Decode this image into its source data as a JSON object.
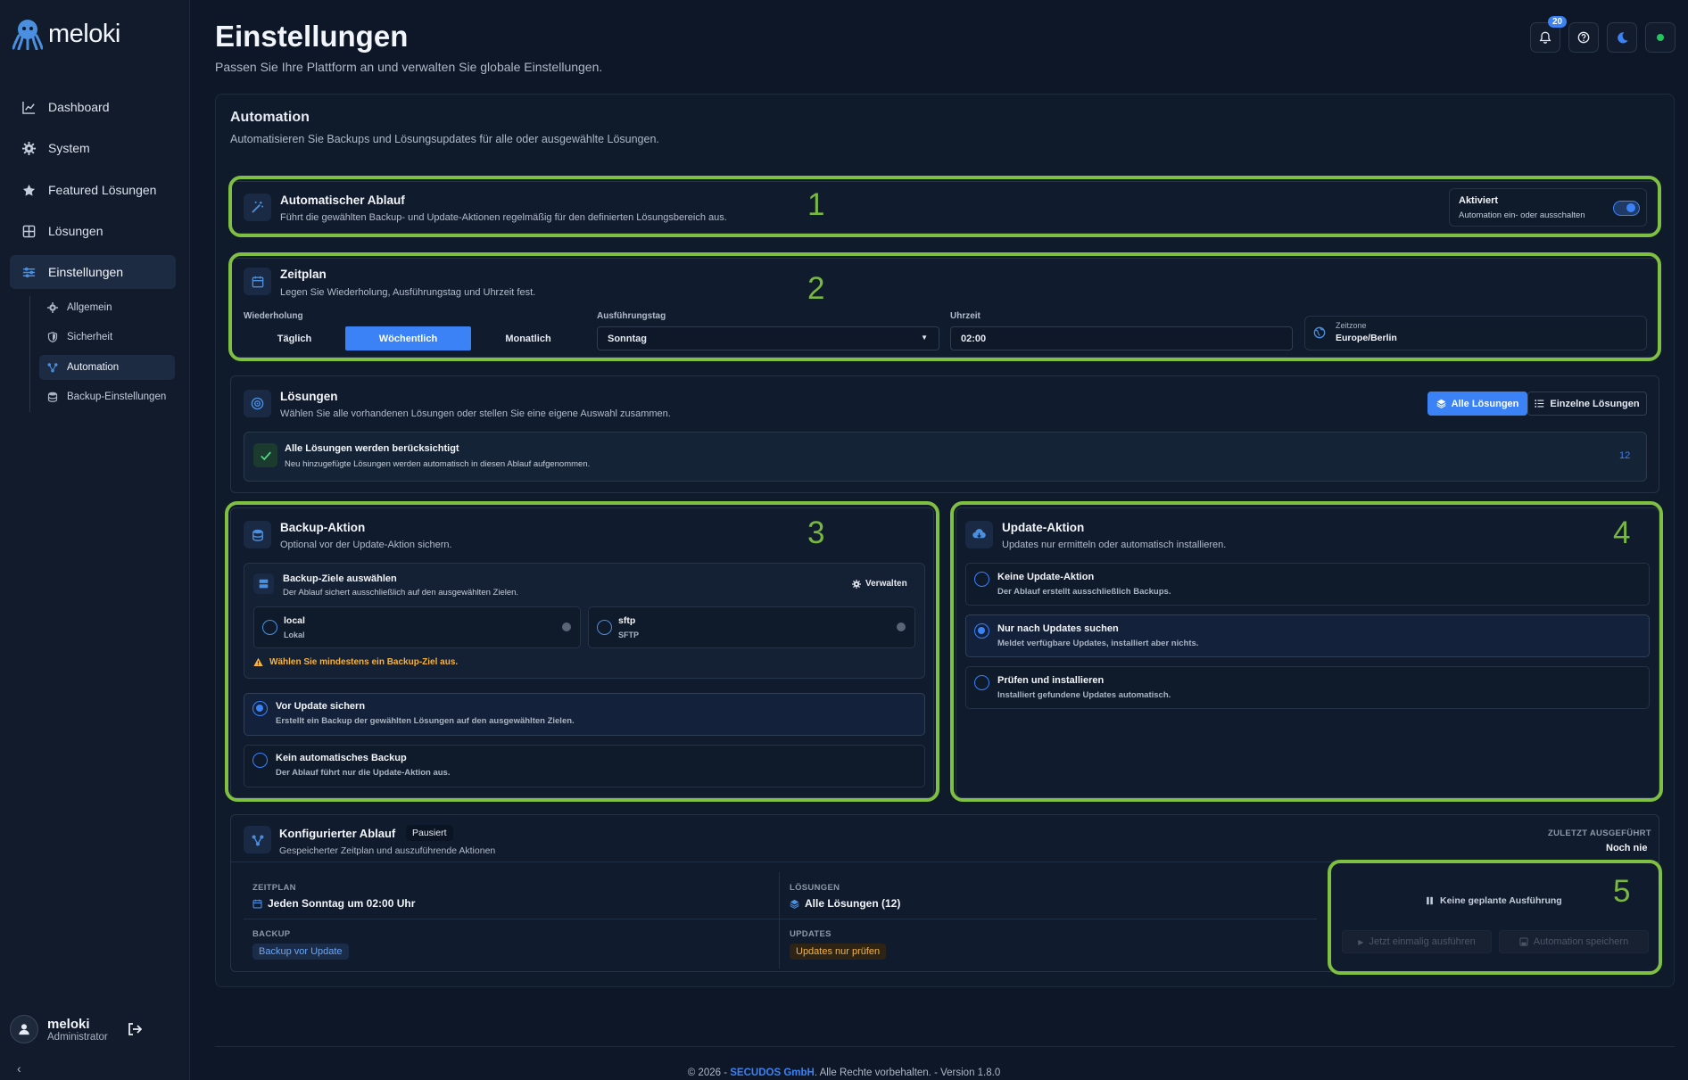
{
  "app": {
    "name": "meloki"
  },
  "sidebar": {
    "items": [
      {
        "label": "Dashboard"
      },
      {
        "label": "System"
      },
      {
        "label": "Featured Lösungen"
      },
      {
        "label": "Lösungen"
      },
      {
        "label": "Einstellungen"
      }
    ],
    "sub_items": [
      {
        "label": "Allgemein"
      },
      {
        "label": "Sicherheit"
      },
      {
        "label": "Automation"
      },
      {
        "label": "Backup-Einstellungen"
      }
    ],
    "user": {
      "name": "meloki",
      "role": "Administrator"
    }
  },
  "header": {
    "title": "Einstellungen",
    "subtitle": "Passen Sie Ihre Plattform an und verwalten Sie globale Einstellungen.",
    "notification_count": "20",
    "status_color": "#22c55e"
  },
  "automation": {
    "title": "Automation",
    "description": "Automatisieren Sie Backups und Lösungsupdates für alle oder ausgewählte Lösungen."
  },
  "annotations": [
    "1",
    "2",
    "3",
    "4",
    "5"
  ],
  "ablauf": {
    "title": "Automatischer Ablauf",
    "description": "Führt die gewählten Backup- und Update-Aktionen regelmäßig für den definierten Lösungsbereich aus.",
    "toggle_title": "Aktiviert",
    "toggle_desc": "Automation ein- oder ausschalten",
    "enabled": true
  },
  "zeitplan": {
    "title": "Zeitplan",
    "description": "Legen Sie Wiederholung, Ausführungstag und Uhrzeit fest.",
    "wiederholung_label": "Wiederholung",
    "options": [
      "Täglich",
      "Wöchentlich",
      "Monatlich"
    ],
    "selected": "Wöchentlich",
    "tag_label": "Ausführungstag",
    "tag_value": "Sonntag",
    "uhrzeit_label": "Uhrzeit",
    "uhrzeit_value": "02:00",
    "zeitzone_label": "Zeitzone",
    "zeitzone_value": "Europe/Berlin"
  },
  "loesungen": {
    "title": "Lösungen",
    "description": "Wählen Sie alle vorhandenen Lösungen oder stellen Sie eine eigene Auswahl zusammen.",
    "btn_all": "Alle Lösungen",
    "btn_single": "Einzelne Lösungen",
    "info_title": "Alle Lösungen werden berücksichtigt",
    "info_desc": "Neu hinzugefügte Lösungen werden automatisch in diesen Ablauf aufgenommen.",
    "count": "12"
  },
  "backup": {
    "title": "Backup-Aktion",
    "description": "Optional vor der Update-Aktion sichern.",
    "targets_title": "Backup-Ziele auswählen",
    "targets_desc": "Der Ablauf sichert ausschließlich auf den ausgewählten Zielen.",
    "manage": "Verwalten",
    "targets": [
      {
        "name": "local",
        "type": "Lokal"
      },
      {
        "name": "sftp",
        "type": "SFTP"
      }
    ],
    "warning": "Wählen Sie mindestens ein Backup-Ziel aus.",
    "options": [
      {
        "title": "Vor Update sichern",
        "desc": "Erstellt ein Backup der gewählten Lösungen auf den ausgewählten Zielen.",
        "selected": true
      },
      {
        "title": "Kein automatisches Backup",
        "desc": "Der Ablauf führt nur die Update-Aktion aus.",
        "selected": false
      }
    ]
  },
  "update": {
    "title": "Update-Aktion",
    "description": "Updates nur ermitteln oder automatisch installieren.",
    "options": [
      {
        "title": "Keine Update-Aktion",
        "desc": "Der Ablauf erstellt ausschließlich Backups.",
        "selected": false
      },
      {
        "title": "Nur nach Updates suchen",
        "desc": "Meldet verfügbare Updates, installiert aber nichts.",
        "selected": true
      },
      {
        "title": "Prüfen und installieren",
        "desc": "Installiert gefundene Updates automatisch.",
        "selected": false
      }
    ]
  },
  "konfig": {
    "title": "Konfigurierter Ablauf",
    "badge": "Pausiert",
    "description": "Gespeicherter Zeitplan und auszuführende Aktionen",
    "last_label": "ZULETZT AUSGEFÜHRT",
    "last_value": "Noch nie",
    "zeitplan_label": "ZEITPLAN",
    "zeitplan_value": "Jeden Sonntag um 02:00 Uhr",
    "loesungen_label": "LÖSUNGEN",
    "loesungen_value": "Alle Lösungen (12)",
    "backup_label": "BACKUP",
    "backup_value": "Backup vor Update",
    "updates_label": "UPDATES",
    "updates_value": "Updates nur prüfen",
    "no_run": "Keine geplante Ausführung",
    "btn_run": "Jetzt einmalig ausführen",
    "btn_save": "Automation speichern"
  },
  "footer": {
    "prefix": "© 2026 - ",
    "company": "SECUDOS GmbH",
    "suffix": ". Alle Rechte vorbehalten. - Version 1.8.0"
  }
}
